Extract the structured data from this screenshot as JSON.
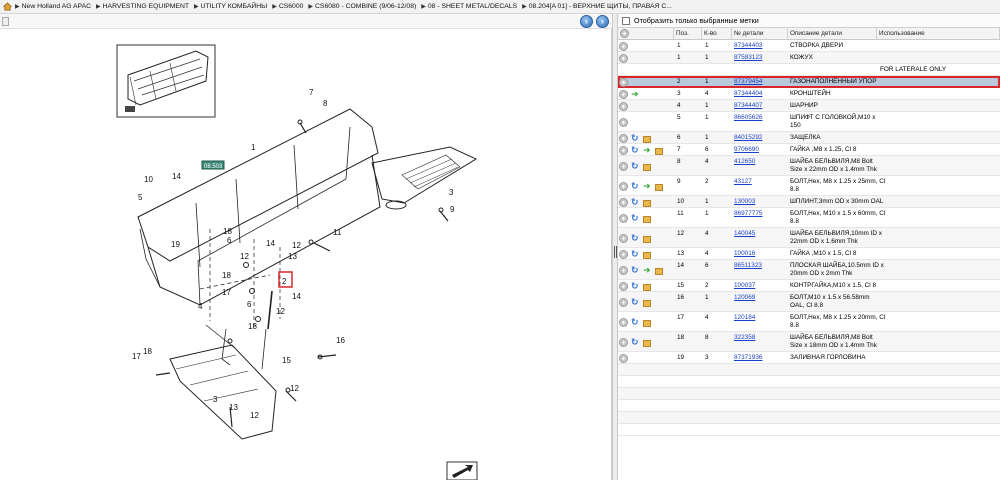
{
  "breadcrumb": [
    "New Holland AG APAC",
    "HARVESTING EQUIPMENT",
    "UTILITY КОМБАЙНЫ",
    "CS6000",
    "CS6080 - COMBINE (9/06-12/08)",
    "08 - SHEET METAL/DECALS",
    "08.204[A 01] - ВЕРХНИЕ ЩИТЫ, ПРАВАЯ С..."
  ],
  "filter_label": "Отобразить только выбранные метки",
  "columns": {
    "pos": "Поз.",
    "qty": "К-во",
    "num": "№ детали",
    "desc": "Описание детали",
    "use": "Использование"
  },
  "diagram": {
    "callout_tag": "08.503",
    "labels": [
      "1",
      "7",
      "8",
      "14",
      "10",
      "5",
      "3",
      "18",
      "6",
      "19",
      "12",
      "9",
      "11",
      "13",
      "12",
      "14",
      "18",
      "17",
      "4",
      "2",
      "14",
      "6",
      "18",
      "12",
      "16",
      "17",
      "18",
      "15",
      "12",
      "3",
      "13",
      "12"
    ]
  },
  "parts_before": [
    {
      "pos": "1",
      "qty": "1",
      "num": "87344403",
      "desc": [
        "СТВОРКА ДВЕРИ"
      ],
      "icons": [
        "plus"
      ]
    },
    {
      "pos": "1",
      "qty": "1",
      "num": "87583123",
      "desc": [
        "КОЖУХ"
      ],
      "icons": [
        "plus"
      ]
    }
  ],
  "note_text": "FOR LATERALE ONLY",
  "selected_part": {
    "pos": "2",
    "qty": "1",
    "num": "87379454",
    "desc": [
      "ГАЗОНАПОЛНЕННЫЙ УПОР"
    ],
    "icons": [
      "plus"
    ]
  },
  "parts_after": [
    {
      "pos": "3",
      "qty": "4",
      "num": "87344404",
      "desc": [
        "КРОНШТЕЙН"
      ],
      "icons": [
        "plus",
        "green"
      ]
    },
    {
      "pos": "4",
      "qty": "1",
      "num": "87344407",
      "desc": [
        "ШАРНИР"
      ],
      "icons": [
        "plus"
      ]
    },
    {
      "pos": "5",
      "qty": "1",
      "num": "86605626",
      "desc": [
        "ШПИФТ С ГОЛОВКОЙ,M10 x",
        "150"
      ],
      "icons": [
        "plus"
      ]
    },
    {
      "pos": "6",
      "qty": "1",
      "num": "84015292",
      "desc": [
        "ЗАЩЕЛКА"
      ],
      "icons": [
        "plus",
        "blue",
        "box"
      ]
    },
    {
      "pos": "7",
      "qty": "6",
      "num": "9706690",
      "desc": [
        "ГАЙКА ,M8 x 1.25, Cl 8"
      ],
      "icons": [
        "plus",
        "blue",
        "green",
        "box"
      ]
    },
    {
      "pos": "8",
      "qty": "4",
      "num": "412650",
      "desc": [
        "ШАЙБА БЕЛЬВИЛЯ,M8 Bolt",
        "Size x 22mm OD x 1.4mm Thk"
      ],
      "icons": [
        "plus",
        "blue",
        "box"
      ]
    },
    {
      "pos": "9",
      "qty": "2",
      "num": "43127",
      "desc": [
        "БОЛТ,Hex, M8 x 1.25 x 25mm, Cl",
        "8.8"
      ],
      "icons": [
        "plus",
        "blue",
        "green",
        "box"
      ]
    },
    {
      "pos": "10",
      "qty": "1",
      "num": "130003",
      "desc": [
        "ШПЛИНТ,3mm OD x 30mm OAL"
      ],
      "icons": [
        "plus",
        "blue",
        "box"
      ]
    },
    {
      "pos": "11",
      "qty": "1",
      "num": "86977775",
      "desc": [
        "БОЛТ,Hex, M10 x 1.5 x 60mm, Cl",
        "8.8"
      ],
      "icons": [
        "plus",
        "blue",
        "box"
      ]
    },
    {
      "pos": "12",
      "qty": "4",
      "num": "140045",
      "desc": [
        "ШАЙБА БЕЛЬВИЛЯ,10mm ID x",
        "22mm OD x 1.6mm Thk"
      ],
      "icons": [
        "plus",
        "blue",
        "box"
      ]
    },
    {
      "pos": "13",
      "qty": "4",
      "num": "100016",
      "desc": [
        "ГАЙКА ,M10 x 1.5, Cl 8"
      ],
      "icons": [
        "plus",
        "blue",
        "box"
      ]
    },
    {
      "pos": "14",
      "qty": "6",
      "num": "86511323",
      "desc": [
        "ПЛОСКАЯ ШАЙБА,10.5mm ID x",
        "20mm OD x 2mm Thk"
      ],
      "icons": [
        "plus",
        "blue",
        "green",
        "box"
      ]
    },
    {
      "pos": "15",
      "qty": "2",
      "num": "100037",
      "desc": [
        "КОНТРГАЙКА,M10 x 1.5, Cl 8"
      ],
      "icons": [
        "plus",
        "blue",
        "box"
      ]
    },
    {
      "pos": "16",
      "qty": "1",
      "num": "120069",
      "desc": [
        "БОЛТ,M10 x 1.5 x 56.58mm",
        "OAL, Cl 8.8"
      ],
      "icons": [
        "plus",
        "blue",
        "box"
      ]
    },
    {
      "pos": "17",
      "qty": "4",
      "num": "120184",
      "desc": [
        "БОЛТ,Hex, M8 x 1.25 x 20mm, Cl",
        "8.8"
      ],
      "icons": [
        "plus",
        "blue",
        "box"
      ]
    },
    {
      "pos": "18",
      "qty": "8",
      "num": "322358",
      "desc": [
        "ШАЙБА БЕЛЬВИЛЯ,M8 Bolt",
        "Size x 18mm OD x 1.4mm Thk"
      ],
      "icons": [
        "plus",
        "blue",
        "box"
      ]
    },
    {
      "pos": "19",
      "qty": "3",
      "num": "87371936",
      "desc": [
        "ЗАЛИВНАЯ ГОРЛОВИНА"
      ],
      "icons": [
        "plus"
      ]
    }
  ]
}
